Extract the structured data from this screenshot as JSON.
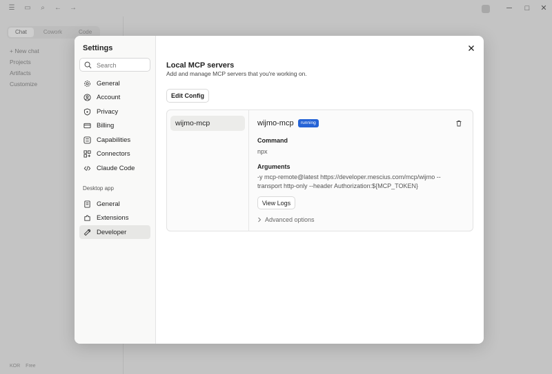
{
  "background": {
    "tabs": [
      "Chat",
      "Cowork",
      "Code"
    ],
    "sidebar_items": [
      "+ New chat",
      "Projects",
      "Artifacts",
      "Customize"
    ],
    "bottom": {
      "user": "KOR",
      "plan": "Free"
    }
  },
  "settings": {
    "title": "Settings",
    "search": {
      "placeholder": "Search",
      "value": ""
    },
    "nav": [
      {
        "label": "General",
        "icon": "gear-icon"
      },
      {
        "label": "Account",
        "icon": "user-circle-icon"
      },
      {
        "label": "Privacy",
        "icon": "shield-icon"
      },
      {
        "label": "Billing",
        "icon": "credit-card-icon"
      },
      {
        "label": "Capabilities",
        "icon": "sliders-icon"
      },
      {
        "label": "Connectors",
        "icon": "connectors-icon"
      },
      {
        "label": "Claude Code",
        "icon": "code-icon"
      }
    ],
    "desktop_section": "Desktop app",
    "desktop_nav": [
      {
        "label": "General",
        "icon": "document-icon"
      },
      {
        "label": "Extensions",
        "icon": "puzzle-icon"
      },
      {
        "label": "Developer",
        "icon": "wrench-icon",
        "active": true
      }
    ]
  },
  "main": {
    "heading": "Local MCP servers",
    "subheading": "Add and manage MCP servers that you're working on.",
    "edit_config_label": "Edit Config",
    "servers": [
      {
        "name": "wijmo-mcp"
      }
    ],
    "detail": {
      "name": "wijmo-mcp",
      "status": "running",
      "command_label": "Command",
      "command_value": "npx",
      "arguments_label": "Arguments",
      "arguments_line1": "-y mcp-remote@latest https://developer.mescius.com/mcp/wijmo --",
      "arguments_line2": "transport http-only --header Authorization:${MCP_TOKEN}",
      "view_logs_label": "View Logs",
      "advanced_label": "Advanced options"
    }
  },
  "colors": {
    "accent": "#2563d6",
    "active_nav": "#e7e7e5"
  }
}
